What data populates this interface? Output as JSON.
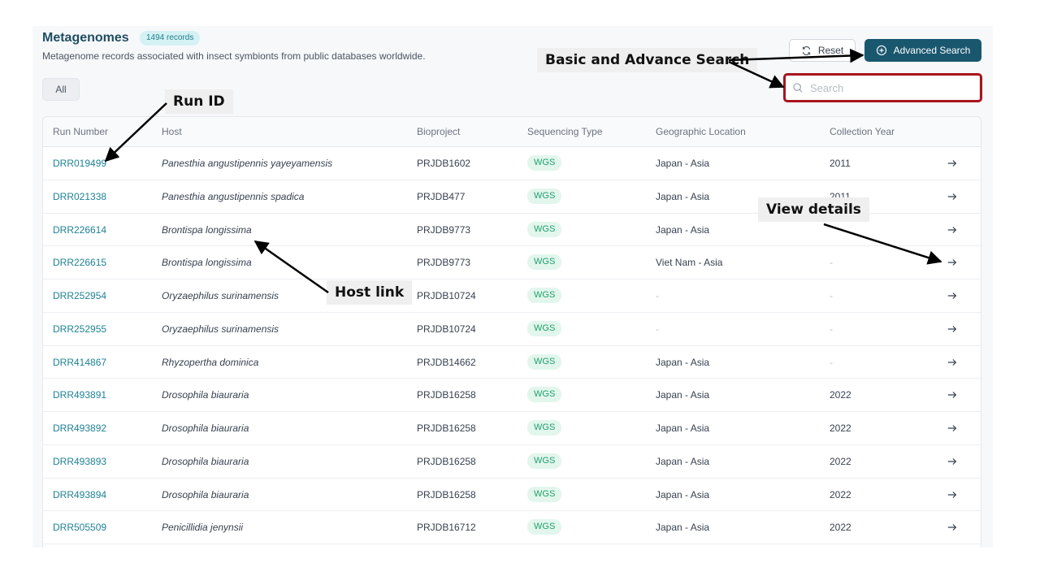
{
  "header": {
    "title": "Metagenomes",
    "record_badge": "1494 records",
    "subtitle": "Metagenome records associated with insect symbionts from public databases worldwide."
  },
  "filters": {
    "all_label": "All"
  },
  "toolbar": {
    "reset_label": "Reset",
    "advanced_label": "Advanced Search",
    "search_placeholder": "Search"
  },
  "table": {
    "columns": [
      "Run Number",
      "Host",
      "Bioproject",
      "Sequencing Type",
      "Geographic Location",
      "Collection Year"
    ],
    "rows": [
      {
        "run": "DRR019499",
        "host": "Panesthia angustipennis yayeyamensis",
        "bioproject": "PRJDB1602",
        "seq": "WGS",
        "geo": "Japan - Asia",
        "year": "2011"
      },
      {
        "run": "DRR021338",
        "host": "Panesthia angustipennis spadica",
        "bioproject": "PRJDB477",
        "seq": "WGS",
        "geo": "Japan - Asia",
        "year": "2011"
      },
      {
        "run": "DRR226614",
        "host": "Brontispa longissima",
        "bioproject": "PRJDB9773",
        "seq": "WGS",
        "geo": "Japan - Asia",
        "year": ""
      },
      {
        "run": "DRR226615",
        "host": "Brontispa longissima",
        "bioproject": "PRJDB9773",
        "seq": "WGS",
        "geo": "Viet Nam - Asia",
        "year": "-"
      },
      {
        "run": "DRR252954",
        "host": "Oryzaephilus surinamensis",
        "bioproject": "PRJDB10724",
        "seq": "WGS",
        "geo": "-",
        "year": "-"
      },
      {
        "run": "DRR252955",
        "host": "Oryzaephilus surinamensis",
        "bioproject": "PRJDB10724",
        "seq": "WGS",
        "geo": "-",
        "year": "-"
      },
      {
        "run": "DRR414867",
        "host": "Rhyzopertha dominica",
        "bioproject": "PRJDB14662",
        "seq": "WGS",
        "geo": "Japan - Asia",
        "year": "-"
      },
      {
        "run": "DRR493891",
        "host": "Drosophila biauraria",
        "bioproject": "PRJDB16258",
        "seq": "WGS",
        "geo": "Japan - Asia",
        "year": "2022"
      },
      {
        "run": "DRR493892",
        "host": "Drosophila biauraria",
        "bioproject": "PRJDB16258",
        "seq": "WGS",
        "geo": "Japan - Asia",
        "year": "2022"
      },
      {
        "run": "DRR493893",
        "host": "Drosophila biauraria",
        "bioproject": "PRJDB16258",
        "seq": "WGS",
        "geo": "Japan - Asia",
        "year": "2022"
      },
      {
        "run": "DRR493894",
        "host": "Drosophila biauraria",
        "bioproject": "PRJDB16258",
        "seq": "WGS",
        "geo": "Japan - Asia",
        "year": "2022"
      },
      {
        "run": "DRR505509",
        "host": "Penicillidia jenynsii",
        "bioproject": "PRJDB16712",
        "seq": "WGS",
        "geo": "Japan - Asia",
        "year": "2022"
      }
    ]
  },
  "annotations": {
    "run_id": "Run ID",
    "search": "Basic and Advance Search",
    "host_link": "Host link",
    "view_details": "View details"
  },
  "colors": {
    "title": "#1e4d63",
    "accent_button": "#19576e",
    "run_link": "#1f8296",
    "wgs_badge_bg": "#e2f6ec",
    "wgs_badge_text": "#22a06b",
    "highlight_box": "#a8141c"
  },
  "icons": [
    "refresh-icon",
    "plus-circle-icon",
    "search-icon",
    "arrow-right-icon"
  ]
}
